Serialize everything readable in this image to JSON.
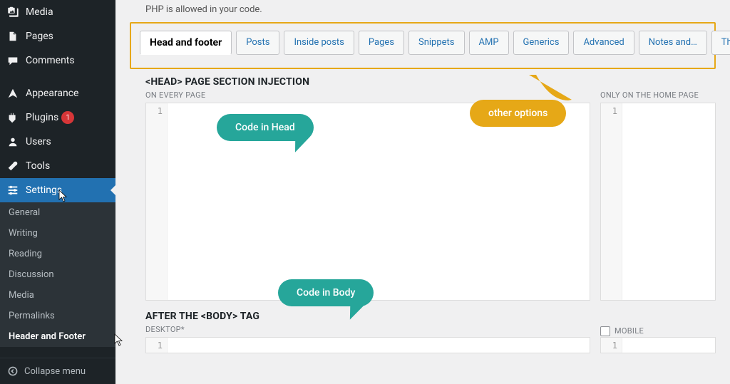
{
  "sidebar": {
    "items": [
      {
        "label": "Media",
        "icon": "media"
      },
      {
        "label": "Pages",
        "icon": "pages"
      },
      {
        "label": "Comments",
        "icon": "comments"
      },
      {
        "label": "Appearance",
        "icon": "appearance"
      },
      {
        "label": "Plugins",
        "icon": "plugins",
        "badge": "1"
      },
      {
        "label": "Users",
        "icon": "users"
      },
      {
        "label": "Tools",
        "icon": "tools"
      },
      {
        "label": "Settings",
        "icon": "settings",
        "active": true
      }
    ],
    "sub": [
      {
        "label": "General"
      },
      {
        "label": "Writing"
      },
      {
        "label": "Reading"
      },
      {
        "label": "Discussion"
      },
      {
        "label": "Media"
      },
      {
        "label": "Permalinks"
      },
      {
        "label": "Header and Footer",
        "active": true
      }
    ],
    "collapse": "Collapse menu"
  },
  "notice": "PHP is allowed in your code.",
  "tabs": [
    "Head and footer",
    "Posts",
    "Inside posts",
    "Pages",
    "Snippets",
    "AMP",
    "Generics",
    "Advanced",
    "Notes and…",
    "Thank you"
  ],
  "sectionHead": {
    "title": "<HEAD> PAGE SECTION INJECTION",
    "subLeft": "ON EVERY PAGE",
    "subRight": "ONLY ON THE HOME PAGE"
  },
  "sectionBody": {
    "title": "AFTER THE <BODY> TAG",
    "subLeft": "DESKTOP*",
    "subRight": "MOBILE"
  },
  "gutter": "1",
  "callouts": {
    "head": "Code in Head",
    "body": "Code in Body",
    "other": "other options"
  },
  "colors": {
    "accent": "#2271b1",
    "tealCallout": "#26a69a",
    "orangeHighlight": "#e6a817",
    "sidebarBg": "#1d2327",
    "badge": "#d63638"
  }
}
